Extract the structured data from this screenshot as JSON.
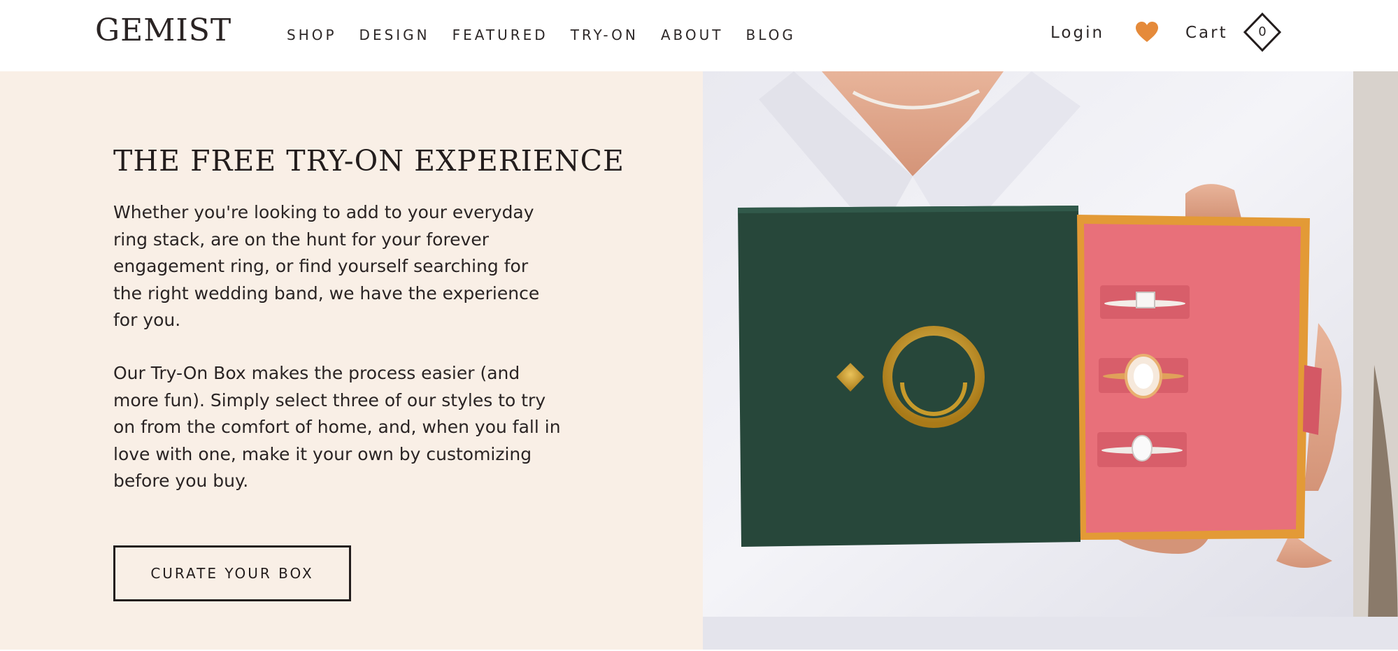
{
  "brand": {
    "logo": "GEMIST"
  },
  "nav": {
    "items": [
      {
        "label": "SHOP"
      },
      {
        "label": "DESIGN"
      },
      {
        "label": "FEATURED"
      },
      {
        "label": "TRY-ON"
      },
      {
        "label": "ABOUT"
      },
      {
        "label": "BLOG"
      }
    ]
  },
  "header_actions": {
    "login": "Login",
    "cart_label": "Cart",
    "cart_count": "0",
    "icons": [
      "heart-icon",
      "cart-diamond-icon"
    ]
  },
  "hero": {
    "headline": "THE FREE TRY-ON EXPERIENCE",
    "paragraph_1": "Whether you're looking to add to your everyday ring stack, are on the hunt for your forever engagement ring, or find yourself searching for the right wedding band, we have the experience for you.",
    "paragraph_2": "Our Try-On Box makes the process easier (and more fun). Simply select three of our styles to try on from the comfort of home, and, when you fall in love with one, make it your own by customizing before you buy.",
    "cta": "CURATE YOUR BOX"
  },
  "colors": {
    "panel_bg": "#f9efe6",
    "heart": "#e58a3a",
    "box_green": "#27473a",
    "box_pink": "#e8707a",
    "gold": "#c79a2b"
  }
}
